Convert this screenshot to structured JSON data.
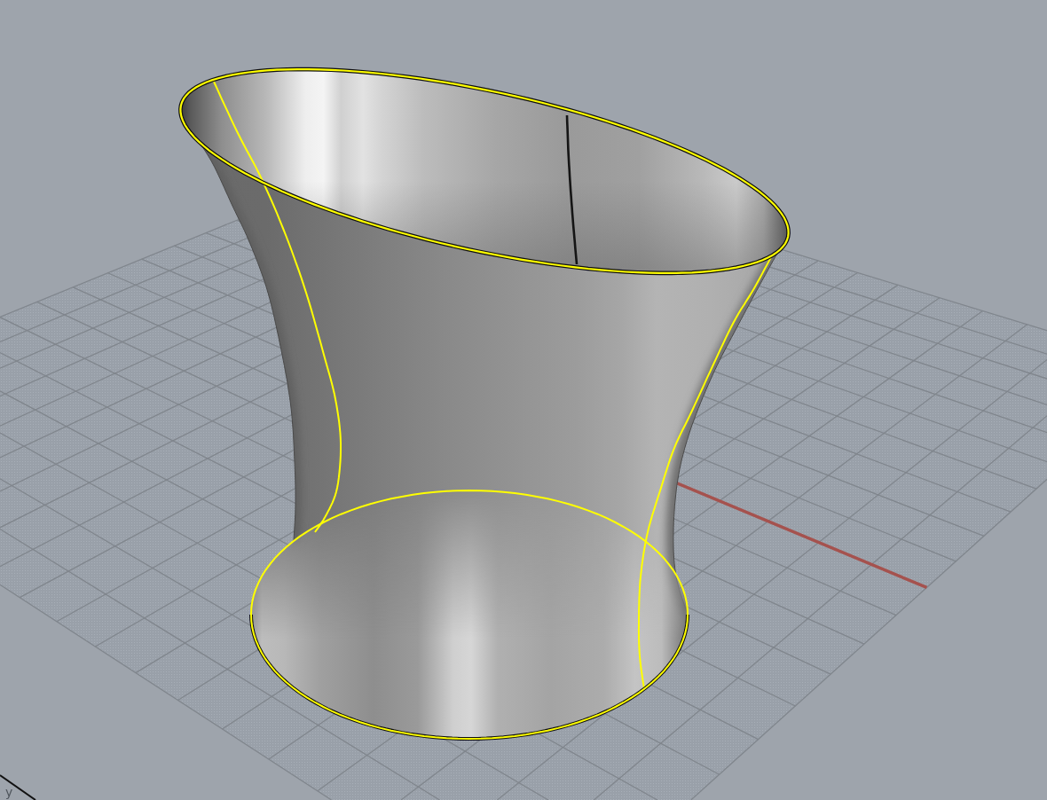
{
  "viewport": {
    "objects": [
      {
        "kind": "surface",
        "selected": true
      },
      {
        "kind": "curve",
        "selected": false
      }
    ],
    "axes_icon": {
      "label": "y"
    }
  }
}
